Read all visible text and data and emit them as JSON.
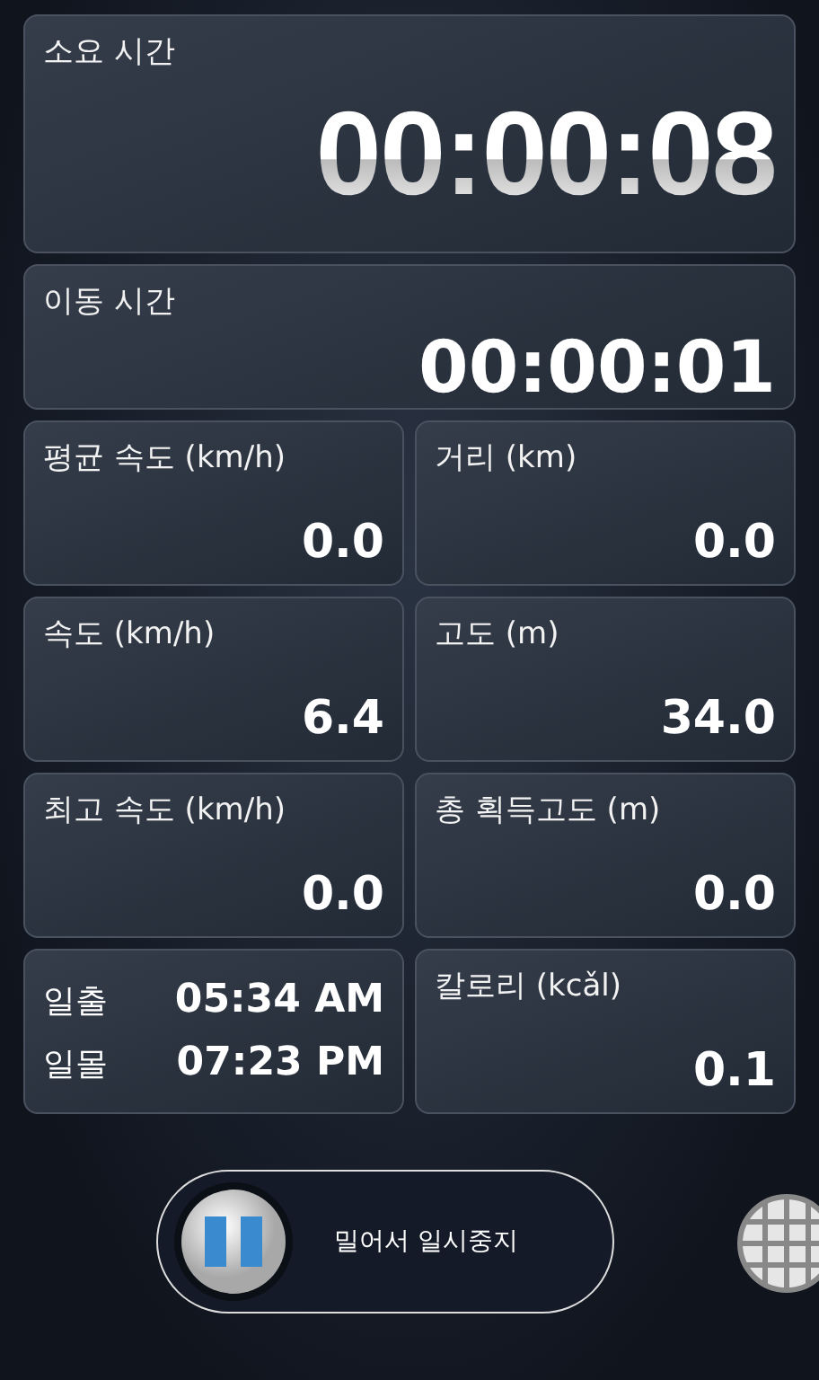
{
  "elapsed": {
    "label": "소요 시간",
    "value": "00:00:08"
  },
  "moving": {
    "label": "이동 시간",
    "value": "00:00:01"
  },
  "stats": [
    {
      "kind": "stat",
      "label": "평균 속도 (km/h)",
      "value": "0.0"
    },
    {
      "kind": "stat",
      "label": "거리 (km)",
      "value": "0.0"
    },
    {
      "kind": "stat",
      "label": "속도 (km/h)",
      "value": "6.4"
    },
    {
      "kind": "stat",
      "label": "고도 (m)",
      "value": "34.0"
    },
    {
      "kind": "stat",
      "label": "최고 속도 (km/h)",
      "value": "0.0"
    },
    {
      "kind": "stat",
      "label": "총 획득고도 (m)",
      "value": "0.0"
    },
    {
      "kind": "sun",
      "rows": [
        {
          "label": "일출",
          "value": "05:34 AM"
        },
        {
          "label": "일몰",
          "value": "07:23 PM"
        }
      ]
    },
    {
      "kind": "stat",
      "label": "칼로리 (kcǎl)",
      "value": "0.1"
    }
  ],
  "slider": {
    "label": "밀어서 일시중지",
    "level": 0
  }
}
